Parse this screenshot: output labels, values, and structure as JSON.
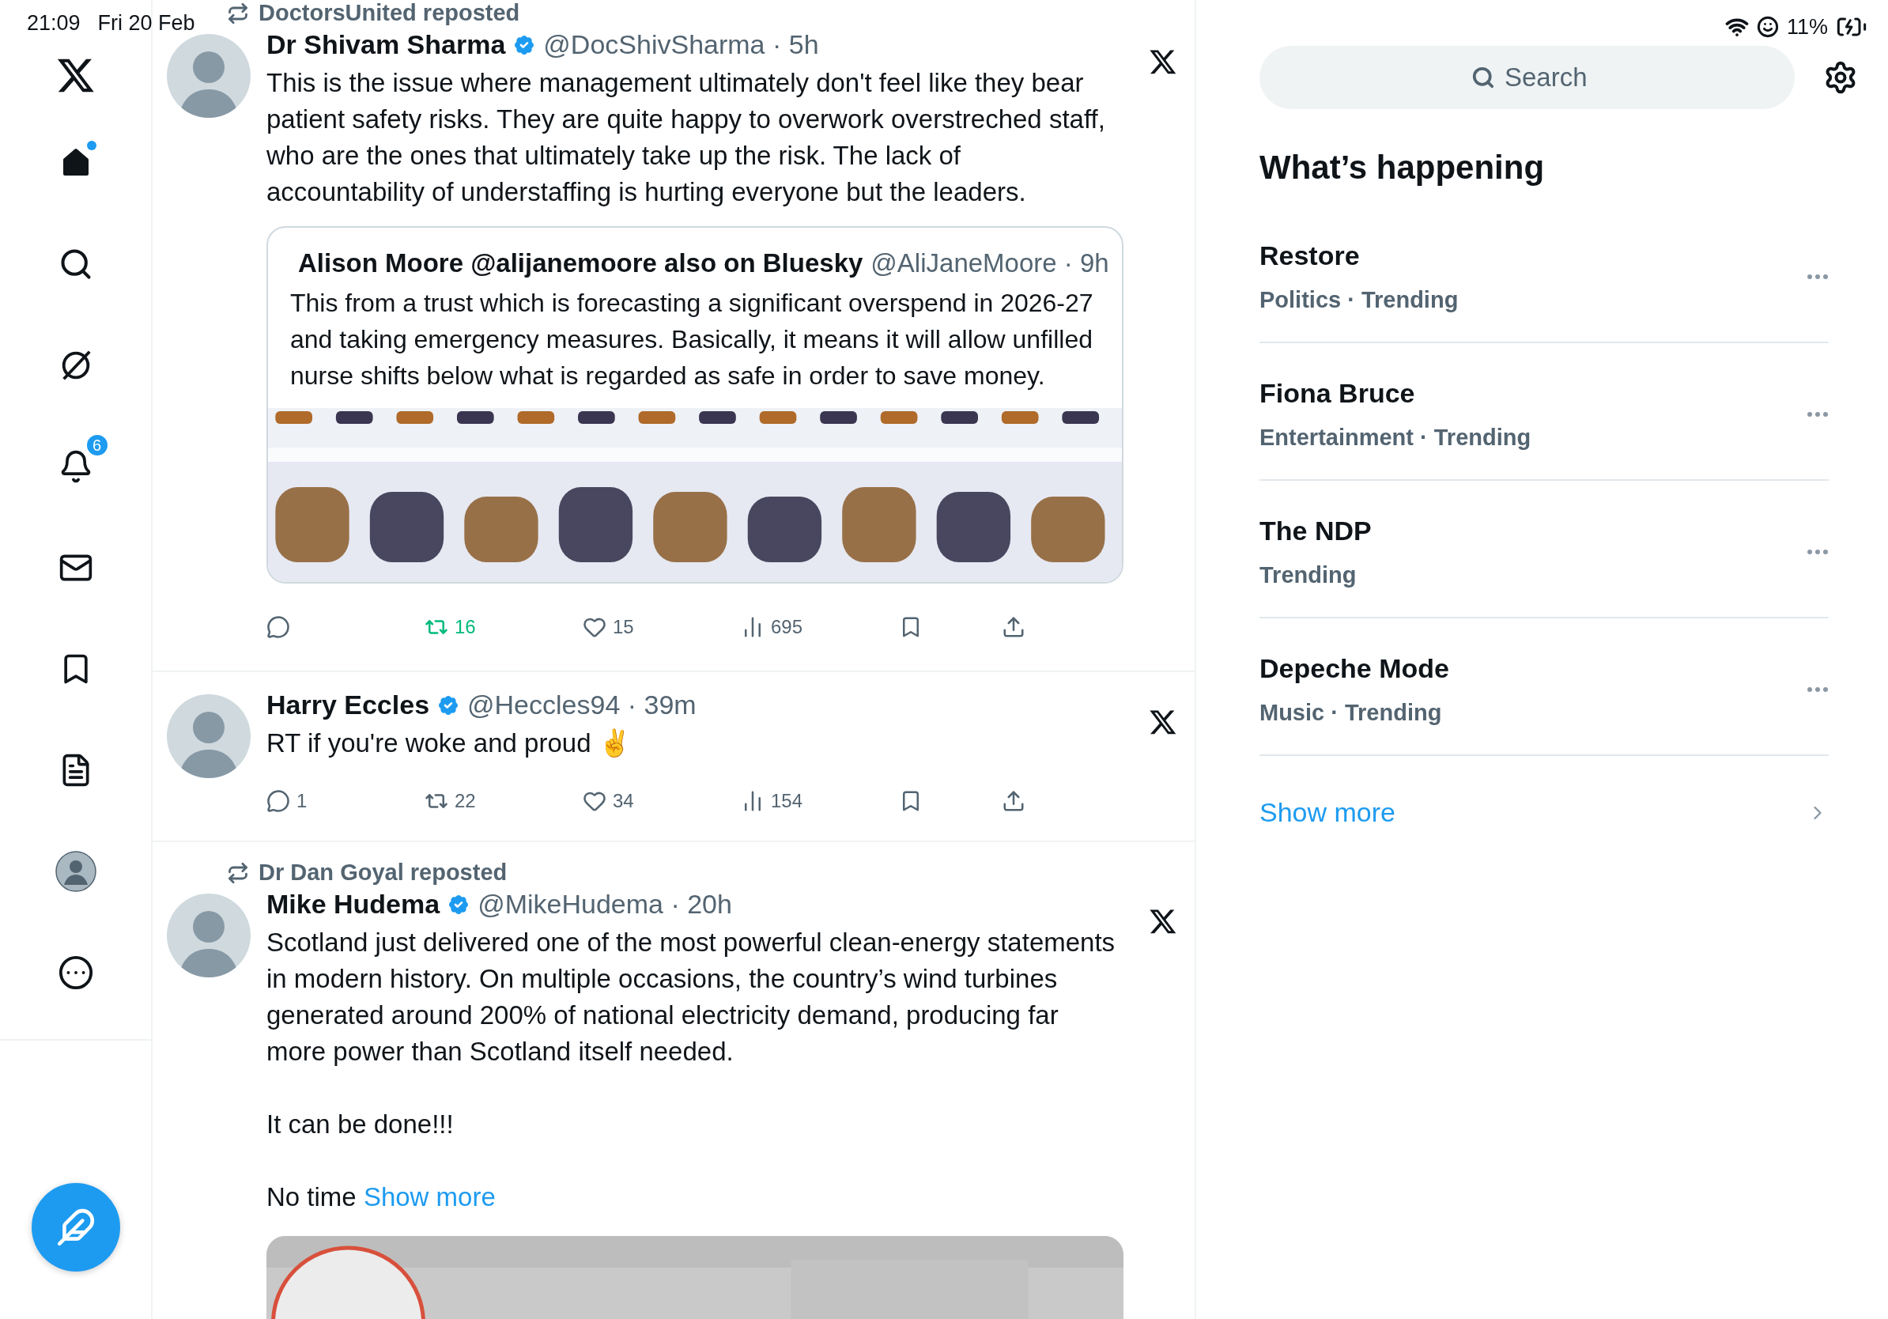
{
  "status_bar": {
    "time": "21:09",
    "date": "Fri 20 Feb",
    "battery": "11%"
  },
  "nav": [
    {
      "kind": "home",
      "selected": true,
      "dot": true
    },
    {
      "kind": "explore",
      "selected": false
    },
    {
      "kind": "grok",
      "selected": false
    },
    {
      "kind": "notifications",
      "selected": false,
      "badge": "6"
    },
    {
      "kind": "messages",
      "selected": false
    },
    {
      "kind": "bookmarks",
      "selected": false
    },
    {
      "kind": "lists",
      "selected": false
    },
    {
      "kind": "profile",
      "selected": false
    },
    {
      "kind": "more",
      "selected": false
    }
  ],
  "tweets": [
    {
      "repost_by": "DoctorsUnited reposted",
      "name": "Dr Shivam Sharma",
      "verified": true,
      "meta": "@DocShivSharma · 5h",
      "paragraphs": [
        "This is the issue where management ultimately don't feel like they bear patient safety risks. They are quite happy to overwork overstreched staff, who are the ones that ultimately take up the risk. The lack of accountability of understaffing is hurting everyone but the leaders."
      ],
      "quote": {
        "name": "Alison Moore @alijanemoore also on Bluesky",
        "meta": "@AliJaneMoore · 9h",
        "text": "This from a trust which is forecasting a significant overspend in 2026-27 and taking emergency measures.  Basically, it means it will allow unfilled nurse shifts below what is regarded as safe in order to save money.",
        "media": {
          "kind": "picture"
        }
      },
      "actions": [
        {
          "kind": "reply"
        },
        {
          "kind": "repost",
          "count": "16",
          "on": true
        },
        {
          "kind": "like",
          "count": "15",
          "on": false
        },
        {
          "kind": "views",
          "count": "695"
        },
        {
          "kind": "bookmark",
          "on": false
        },
        {
          "kind": "share"
        }
      ]
    },
    {
      "name": "Harry Eccles",
      "verified": true,
      "meta": "@Heccles94 · 39m",
      "paragraphs": [
        "RT if you're woke and proud ✌️"
      ],
      "actions": [
        {
          "kind": "reply",
          "count": "1"
        },
        {
          "kind": "repost",
          "count": "22",
          "on": false
        },
        {
          "kind": "like",
          "count": "34",
          "on": false
        },
        {
          "kind": "views",
          "count": "154"
        },
        {
          "kind": "bookmark",
          "on": false
        },
        {
          "kind": "share"
        }
      ]
    },
    {
      "repost_by": "Dr Dan Goyal reposted",
      "name": "Mike Hudema",
      "verified": true,
      "meta": "@MikeHudema · 20h",
      "paragraphs": [
        "Scotland just delivered one of the most powerful clean-energy statements in modern history. On multiple occasions, the country’s wind turbines generated around 200% of national electricity demand, producing far more power than Scotland itself needed.",
        "It can be done!!!",
        "No time"
      ],
      "more_link": "Show more",
      "media": {
        "kind": "picture"
      }
    }
  ],
  "search": {
    "placeholder": "Search"
  },
  "trends_title": "What’s happening",
  "trends": [
    {
      "name": "Restore",
      "context": "Politics · Trending"
    },
    {
      "name": "Fiona Bruce",
      "context": "Entertainment · Trending"
    },
    {
      "name": "The NDP",
      "context": "Trending"
    },
    {
      "name": "Depeche Mode",
      "context": "Music · Trending"
    }
  ],
  "show_more": "Show more"
}
